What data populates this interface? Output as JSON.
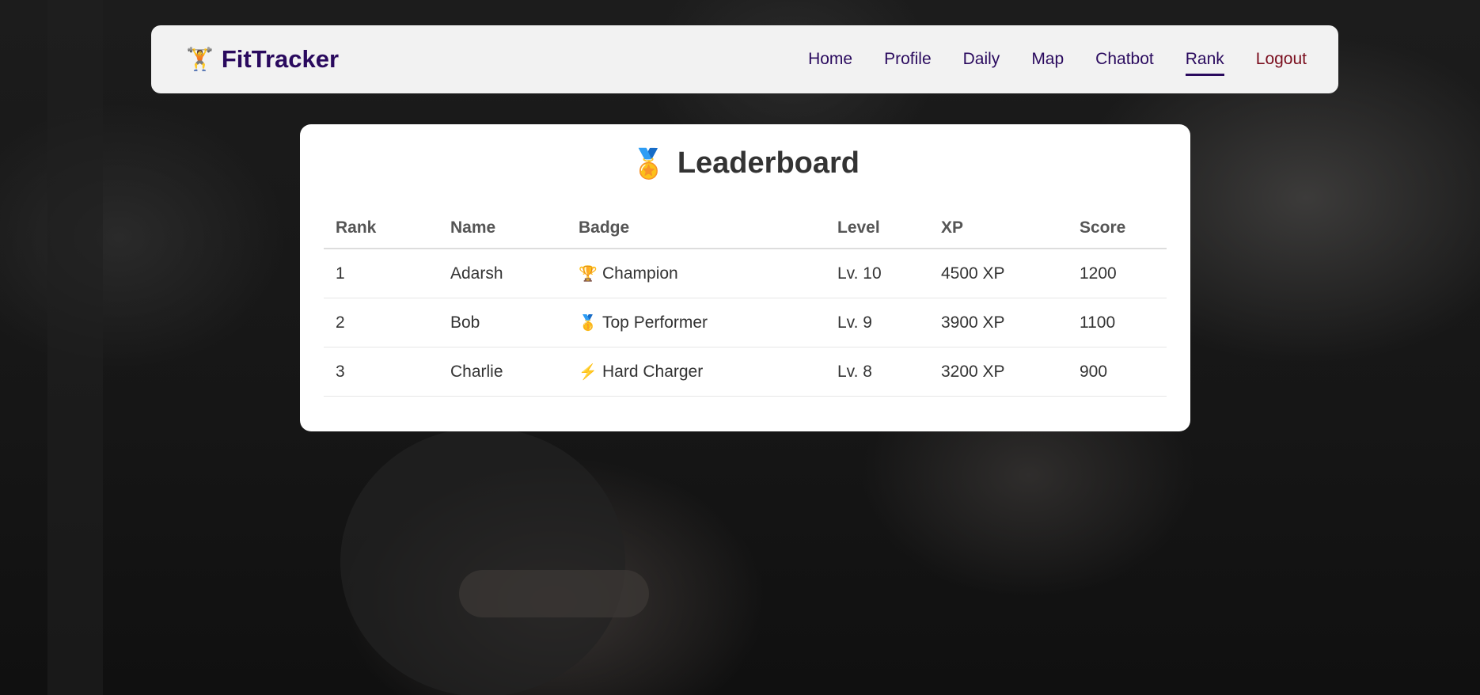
{
  "brand": {
    "icon": "🏋️",
    "name": "FitTracker"
  },
  "nav": {
    "items": [
      {
        "label": "Home"
      },
      {
        "label": "Profile"
      },
      {
        "label": "Daily"
      },
      {
        "label": "Map"
      },
      {
        "label": "Chatbot"
      },
      {
        "label": "Rank",
        "active": true
      },
      {
        "label": "Logout"
      }
    ]
  },
  "leaderboard": {
    "icon": "🏅",
    "title": "Leaderboard",
    "columns": [
      "Rank",
      "Name",
      "Badge",
      "Level",
      "XP",
      "Score"
    ],
    "rows": [
      {
        "rank": "1",
        "name": "Adarsh",
        "badge_icon": "🏆",
        "badge": "Champion",
        "level": "Lv. 10",
        "xp": "4500 XP",
        "score": "1200"
      },
      {
        "rank": "2",
        "name": "Bob",
        "badge_icon": "🥇",
        "badge": "Top Performer",
        "level": "Lv. 9",
        "xp": "3900 XP",
        "score": "1100"
      },
      {
        "rank": "3",
        "name": "Charlie",
        "badge_icon": "⚡",
        "badge": "Hard Charger",
        "level": "Lv. 8",
        "xp": "3200 XP",
        "score": "900"
      }
    ]
  },
  "colors": {
    "brand": "#2a0a5e",
    "logout": "#7a0e1e",
    "card_bg": "#ffffff",
    "nav_bg": "#f2f2f2"
  }
}
